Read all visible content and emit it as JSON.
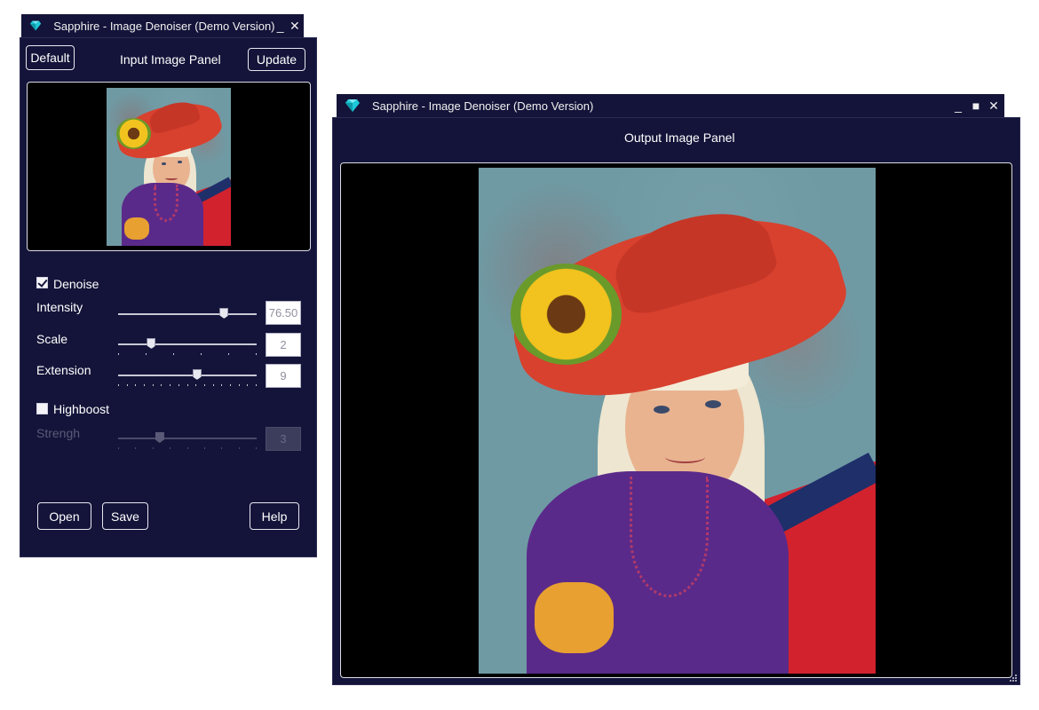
{
  "left_window": {
    "title": "Sapphire - Image Denoiser (Demo Version)",
    "minimize_glyph": "_",
    "close_glyph": "✕",
    "default_label": "Default",
    "panel_title": "Input Image Panel",
    "update_label": "Update",
    "denoise": {
      "label": "Denoise",
      "checked": true,
      "intensity": {
        "label": "Intensity",
        "value": "76.50",
        "fraction": 0.765
      },
      "scale": {
        "label": "Scale",
        "value": "2",
        "fraction": 0.24
      },
      "extension": {
        "label": "Extension",
        "value": "9",
        "fraction": 0.57
      }
    },
    "highboost": {
      "label": "Highboost",
      "checked": false,
      "strength": {
        "label": "Strengh",
        "value": "3",
        "fraction": 0.3
      }
    },
    "open_label": "Open",
    "save_label": "Save",
    "help_label": "Help"
  },
  "right_window": {
    "title": "Sapphire - Image Denoiser (Demo Version)",
    "minimize_glyph": "_",
    "maximize_glyph": "■",
    "close_glyph": "✕",
    "panel_title": "Output Image Panel"
  },
  "icons": {
    "app": "diamond-icon",
    "minimize": "minimize-icon",
    "maximize": "maximize-icon",
    "close": "close-icon"
  },
  "colors": {
    "window_bg": "#14143a",
    "accent": "#1ec8d8"
  }
}
